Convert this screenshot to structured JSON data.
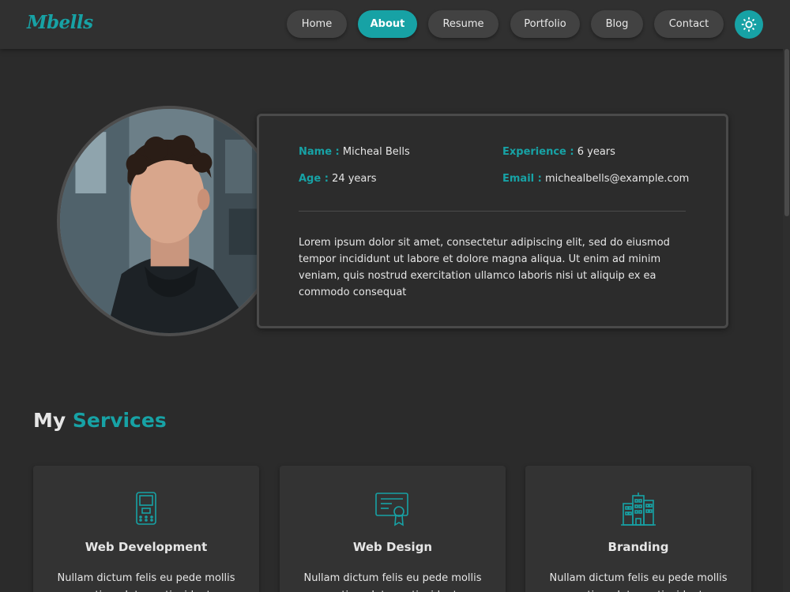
{
  "brand": {
    "logo": "Mbells",
    "accent": "#17a2a5"
  },
  "nav": {
    "items": [
      {
        "label": "Home",
        "active": false
      },
      {
        "label": "About",
        "active": true
      },
      {
        "label": "Resume",
        "active": false
      },
      {
        "label": "Portfolio",
        "active": false
      },
      {
        "label": "Blog",
        "active": false
      },
      {
        "label": "Contact",
        "active": false
      }
    ],
    "settings_icon": "gear-icon"
  },
  "about": {
    "name_label": "Name :",
    "name_value": "Micheal Bells",
    "experience_label": "Experience :",
    "experience_value": "6 years",
    "age_label": "Age :",
    "age_value": "24 years",
    "email_label": "Email :",
    "email_value": "michealbells@example.com",
    "bio": "Lorem ipsum dolor sit amet, consectetur adipiscing elit, sed do eiusmod tempor incididunt ut labore et dolore magna aliqua. Ut enim ad minim veniam, quis nostrud exercitation ullamco laboris nisi ut aliquip ex ea commodo consequat"
  },
  "services": {
    "title_part1": "My",
    "title_part2": "Services",
    "cards": [
      {
        "title": "Web Development",
        "icon": "mobile-phone-icon",
        "text": "Nullam dictum felis eu pede mollis pretium. Integer tincidunt."
      },
      {
        "title": "Web Design",
        "icon": "certificate-icon",
        "text": "Nullam dictum felis eu pede mollis pretium. Integer tincidunt."
      },
      {
        "title": "Branding",
        "icon": "buildings-icon",
        "text": "Nullam dictum felis eu pede mollis pretium. Integer tincidunt."
      }
    ]
  }
}
